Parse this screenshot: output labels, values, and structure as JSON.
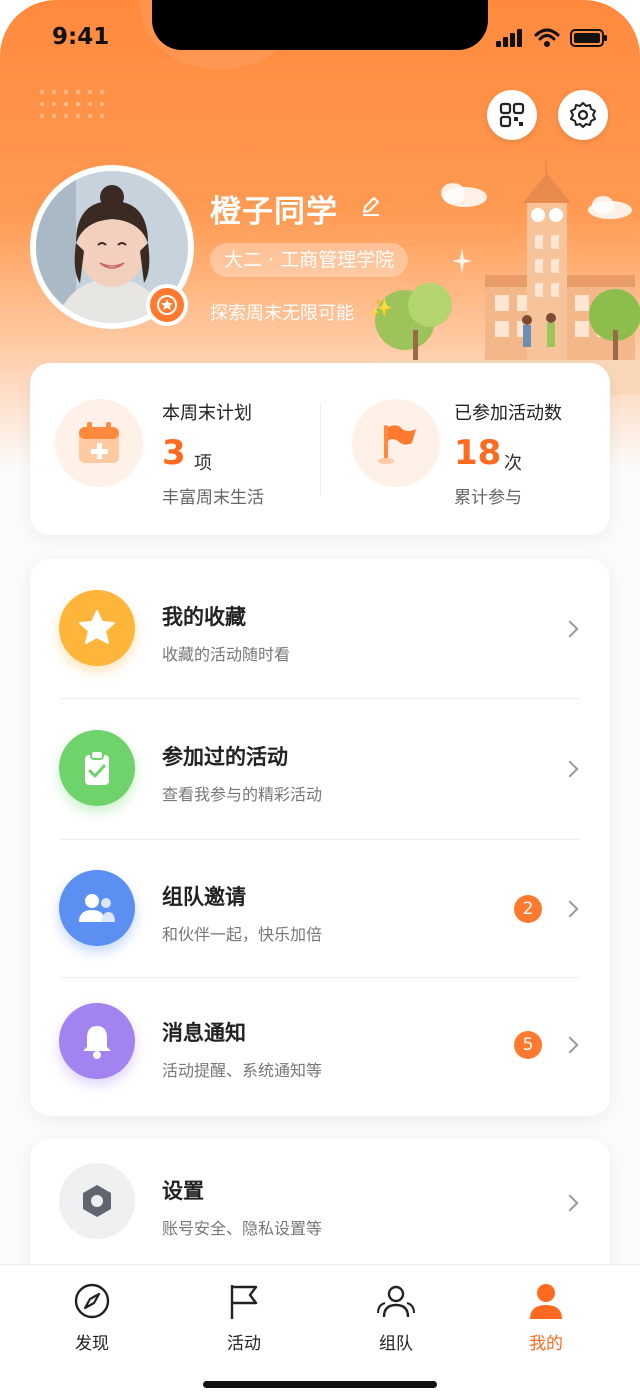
{
  "status_bar": {
    "time": "9:41"
  },
  "header": {
    "qr_icon": "qr-code-icon",
    "settings_icon": "gear-icon",
    "name": "橙子同学",
    "department": "大二 · 工商管理学院",
    "slogan": "探索周末无限可能",
    "sparkle": "✨"
  },
  "stats": {
    "plan": {
      "title": "本周末计划",
      "value": "3",
      "unit": "项",
      "sub": "丰富周末生活"
    },
    "joined": {
      "title": "已参加活动数",
      "value": "18",
      "unit": "次",
      "sub": "累计参与"
    }
  },
  "menu": [
    {
      "title": "我的收藏",
      "sub": "收藏的活动随时看",
      "icon": "star-icon",
      "color": "#ffb43a",
      "badge": ""
    },
    {
      "title": "参加过的活动",
      "sub": "查看我参与的精彩活动",
      "icon": "clipboard-check-icon",
      "color": "#6ed36a",
      "badge": ""
    },
    {
      "title": "组队邀请",
      "sub": "和伙伴一起，快乐加倍",
      "icon": "team-icon",
      "color": "#5b8ff2",
      "badge": "2"
    },
    {
      "title": "消息通知",
      "sub": "活动提醒、系统通知等",
      "icon": "bell-icon",
      "color": "#a283f0",
      "badge": "5"
    }
  ],
  "settings": {
    "title": "设置",
    "sub": "账号安全、隐私设置等"
  },
  "tabbar": [
    {
      "label": "发现",
      "icon": "compass-icon",
      "active": false
    },
    {
      "label": "活动",
      "icon": "flag-icon",
      "active": false
    },
    {
      "label": "组队",
      "icon": "team-icon",
      "active": false
    },
    {
      "label": "我的",
      "icon": "person-icon",
      "active": true
    }
  ],
  "colors": {
    "accent": "#ff6a1f",
    "hero": "#ff8a3d"
  }
}
